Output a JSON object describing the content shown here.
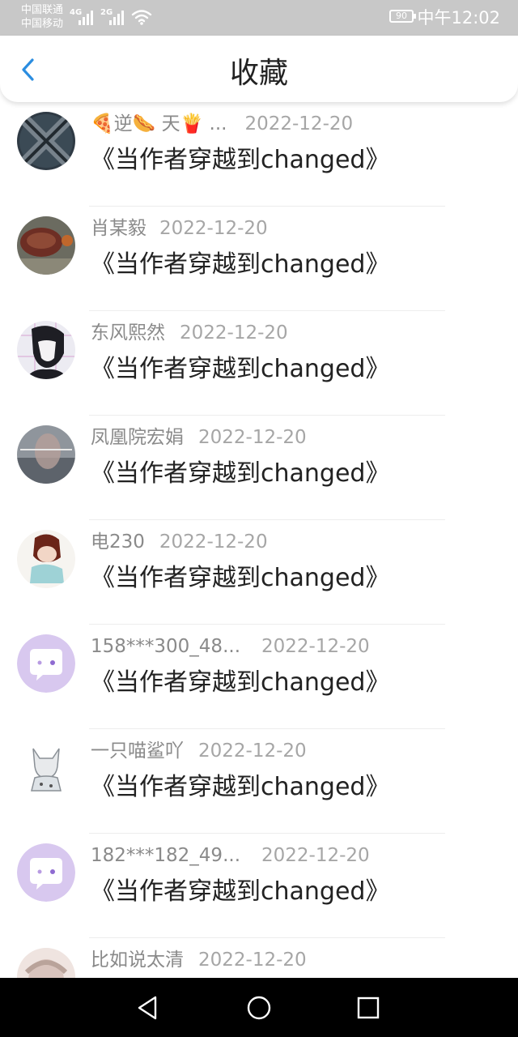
{
  "status_bar": {
    "carrier1": "中国联通",
    "carrier2": "中国移动",
    "net1": "4G",
    "net2": "2G",
    "battery": "90",
    "time": "中午12:02"
  },
  "header": {
    "title": "收藏"
  },
  "items": [
    {
      "name": "🍕逆🌭 天🍟 ...",
      "date": "2022-12-20",
      "book": "《当作者穿越到changed》",
      "gap": 22
    },
    {
      "name": "肖某毅",
      "date": "2022-12-20",
      "book": "《当作者穿越到changed》",
      "gap": 16
    },
    {
      "name": "东风熙然",
      "date": "2022-12-20",
      "book": "《当作者穿越到changed》",
      "gap": 18
    },
    {
      "name": "凤凰院宏娟",
      "date": "2022-12-20",
      "book": "《当作者穿越到changed》",
      "gap": 18
    },
    {
      "name": "电230",
      "date": "2022-12-20",
      "book": "《当作者穿越到changed》",
      "gap": 18
    },
    {
      "name": "158***300_48...",
      "date": "2022-12-20",
      "book": "《当作者穿越到changed》",
      "gap": 26
    },
    {
      "name": "一只喵鲨吖",
      "date": "2022-12-20",
      "book": "《当作者穿越到changed》",
      "gap": 18
    },
    {
      "name": "182***182_49...",
      "date": "2022-12-20",
      "book": "《当作者穿越到changed》",
      "gap": 26
    },
    {
      "name": "比如说太清",
      "date": "2022-12-20",
      "book": "",
      "gap": 18
    }
  ],
  "avatar_colors": [
    "#2f3a44",
    "#7a4a3a",
    "#e9e9f0",
    "#9aa0a8",
    "#f2eee8",
    "#d8c8ef",
    "#eef0f2",
    "#d8c8ef",
    "#efe4e0"
  ],
  "icons": [
    "back-arrow-icon",
    "nav-back-icon",
    "nav-home-icon",
    "nav-recents-icon"
  ]
}
